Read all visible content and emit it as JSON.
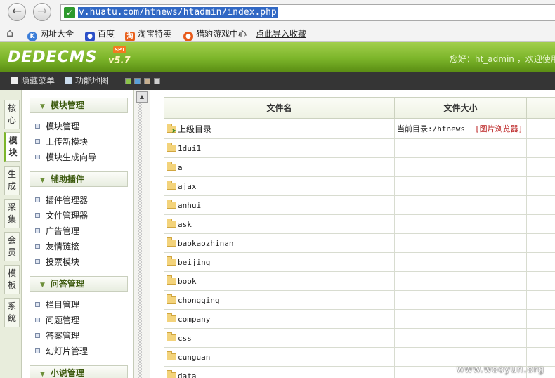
{
  "browser": {
    "url": "v.huatu.com/htnews/htadmin/index.php",
    "bookmarks": [
      "网址大全",
      "百度",
      "淘宝特卖",
      "猎豹游戏中心"
    ],
    "import_label": "点此导入收藏"
  },
  "cms": {
    "logo": "DEDECMS",
    "version": "v5.7",
    "sp_badge": "SP1",
    "welcome": "您好：ht_admin ，欢迎使用"
  },
  "toolbar": {
    "hide_menu": "隐藏菜单",
    "site_map": "功能地图",
    "skin_colors": [
      "#8bc34a",
      "#5aa0d8",
      "#c8b090",
      "#d0d0d0"
    ]
  },
  "vertical_tabs": [
    "核心",
    "模块",
    "生成",
    "采集",
    "会员",
    "模板",
    "系统"
  ],
  "active_tab": "模块",
  "menu_groups": [
    {
      "title": "模块管理",
      "items": [
        "模块管理",
        "上传新模块",
        "模块生成向导"
      ]
    },
    {
      "title": "辅助插件",
      "items": [
        "插件管理器",
        "文件管理器",
        "广告管理",
        "友情链接",
        "投票模块"
      ]
    },
    {
      "title": "问答管理",
      "items": [
        "栏目管理",
        "问题管理",
        "答案管理",
        "幻灯片管理"
      ]
    },
    {
      "title": "小说管理",
      "items": []
    }
  ],
  "file_table": {
    "headers": {
      "name": "文件名",
      "size": "文件大小"
    },
    "parent_label": "上级目录",
    "current_dir": "当前目录:/htnews",
    "image_browser": "[图片浏览器]",
    "folders": [
      "1dui1",
      "a",
      "ajax",
      "anhui",
      "ask",
      "baokaozhinan",
      "beijing",
      "book",
      "chongqing",
      "company",
      "css",
      "cunguan",
      "data"
    ]
  },
  "watermark": "www.wooyun.org"
}
